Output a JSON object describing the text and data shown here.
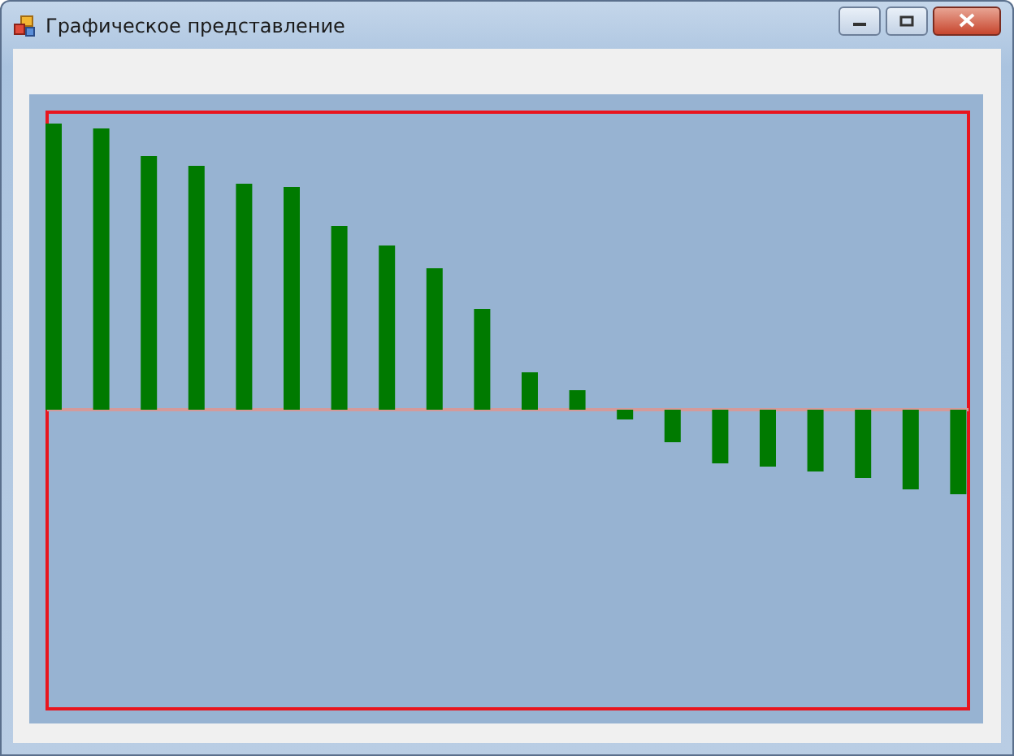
{
  "window": {
    "title": "Графическое представление"
  }
}
